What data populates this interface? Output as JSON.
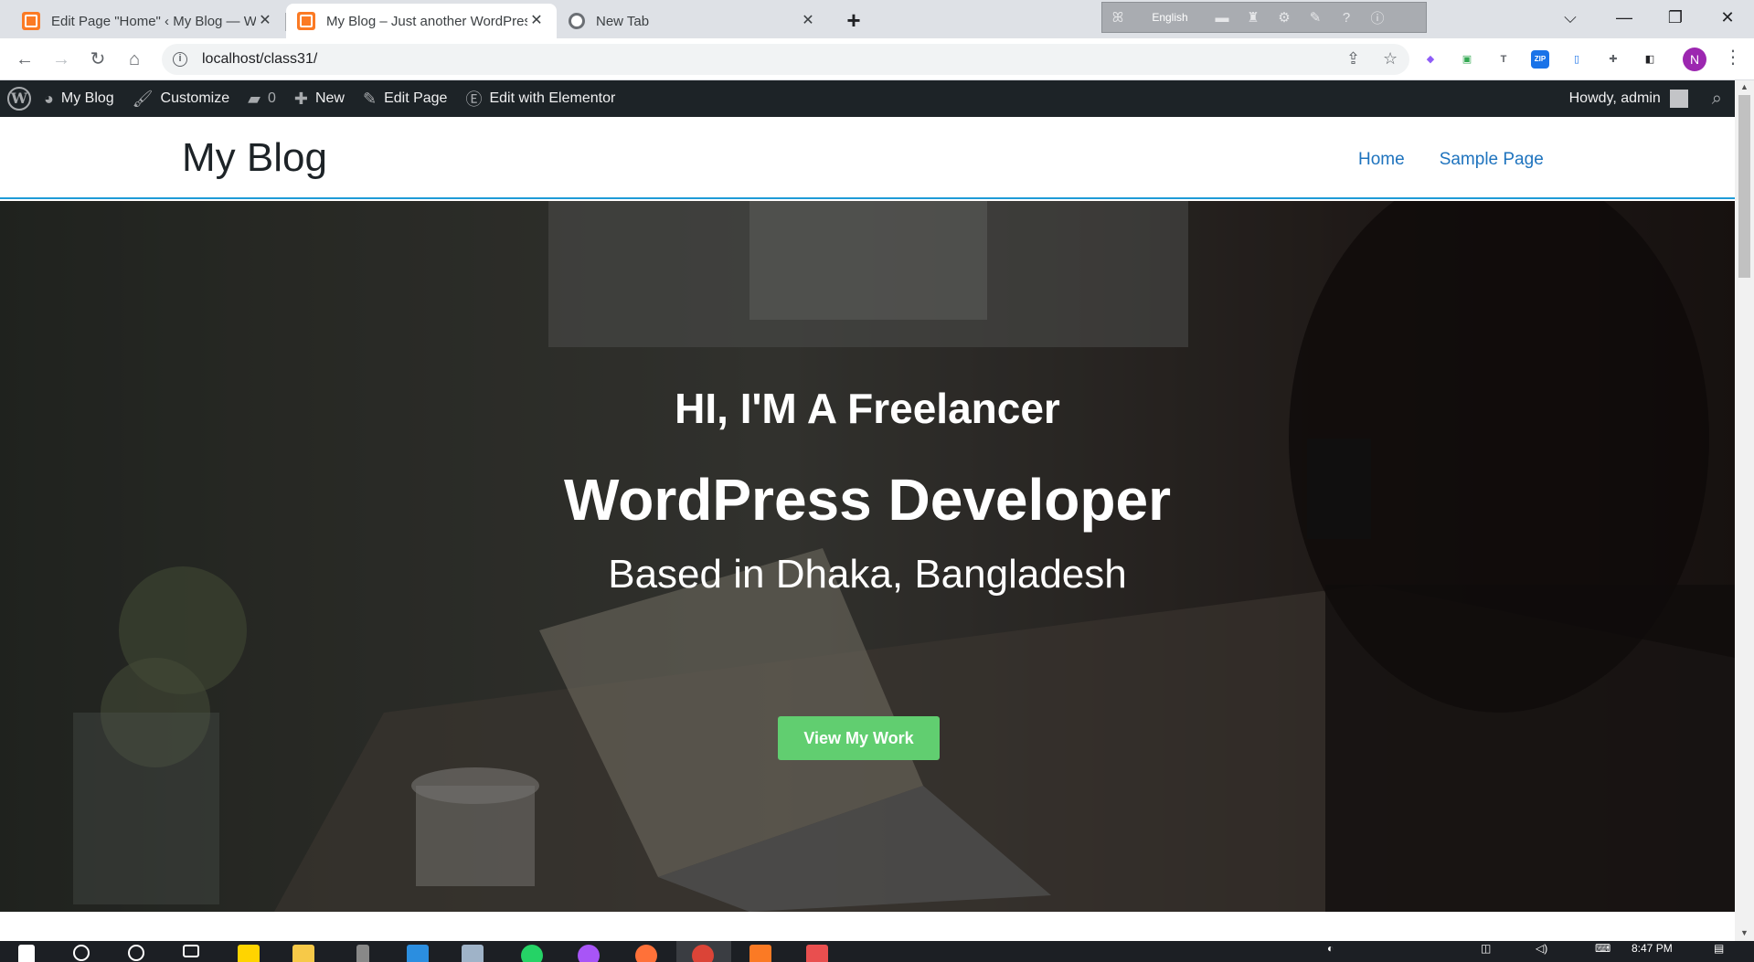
{
  "browser": {
    "tabs": [
      {
        "title": "Edit Page \"Home\" ‹ My Blog — W",
        "favicon": "xampp-icon",
        "active": false
      },
      {
        "title": "My Blog – Just another WordPres",
        "favicon": "xampp-icon",
        "active": true
      },
      {
        "title": "New Tab",
        "favicon": "chrome-icon",
        "active": false
      }
    ],
    "tab_close_glyph": "✕",
    "new_tab_glyph": "+",
    "language_widget": {
      "language": "English"
    },
    "window_controls": {
      "chevron": "⌵",
      "minimize": "—",
      "restore": "❐",
      "close": "✕"
    },
    "url": "localhost/class31/",
    "profile_initial": "N",
    "extensions": [
      {
        "name": "ext-puzzle-color-icon",
        "glyph": "◆",
        "color": "#8e5cf7"
      },
      {
        "name": "ext-image-icon",
        "glyph": "▣",
        "color": "#34a853"
      },
      {
        "name": "ext-font-icon",
        "glyph": "T",
        "color": "#5f6368"
      },
      {
        "name": "ext-zip-icon",
        "glyph": "ZIP",
        "color": "#1a73e8"
      },
      {
        "name": "ext-phone-icon",
        "glyph": "▯",
        "color": "#1a73e8"
      },
      {
        "name": "extensions-icon",
        "glyph": "✚",
        "color": "#5f6368"
      },
      {
        "name": "side-panel-icon",
        "glyph": "◧",
        "color": "#202124"
      }
    ]
  },
  "adminbar": {
    "site": "My Blog",
    "customize": "Customize",
    "comments": "0",
    "new": "New",
    "edit_page": "Edit Page",
    "elementor": "Edit with Elementor",
    "howdy": "Howdy, admin"
  },
  "site": {
    "title": "My Blog",
    "nav": [
      "Home",
      "Sample Page"
    ]
  },
  "hero": {
    "eyebrow": "HI, I'M A Freelancer",
    "headline": "WordPress Developer",
    "location": "Based in Dhaka, Bangladesh",
    "button": "View My Work"
  },
  "taskbar": {
    "time": "8:47 PM"
  },
  "colors": {
    "accent_link": "#1e73be",
    "button_green": "#61ce70",
    "adminbar_bg": "#1d2327",
    "header_border": "#1e9bd7"
  }
}
